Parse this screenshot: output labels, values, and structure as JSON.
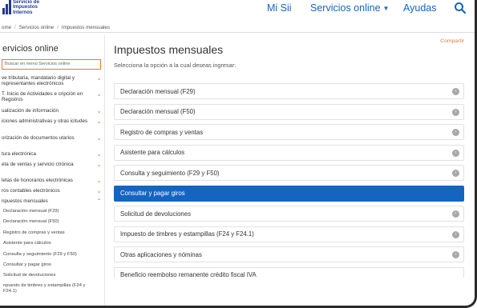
{
  "header": {
    "logo_line1": "Servicio de",
    "logo_line2": "Impuestos",
    "logo_line3": "Internos",
    "nav": {
      "mi_sii": "Mi Sii",
      "servicios": "Servicios online",
      "ayudas": "Ayudas"
    }
  },
  "breadcrumb": [
    "ome",
    "Servicios online",
    "Impuestos mensuales"
  ],
  "sidebar": {
    "title": "ervicios online",
    "search_placeholder": "Buscar en menú Servicios online",
    "items": [
      {
        "label": "ve tributaria, mandatario digital y representantes electrónicos"
      },
      {
        "label": "T. Inicio de Actividades e cripción en Registros"
      },
      {
        "label": "ualización de información"
      },
      {
        "label": "iciones administrativas y otras icitudes"
      },
      {
        "label": "orización de documentos utarios"
      },
      {
        "label": "tura electrónica"
      },
      {
        "label": "eta de ventas y servicio ctrónica"
      },
      {
        "label": "letas de honorarios electrónicas"
      },
      {
        "label": "ros contables electrónicos"
      },
      {
        "label": "npuestos mensuales"
      }
    ],
    "sub_items": [
      "Declaración mensual (F29)",
      "Declaración mensual (F50)",
      "Registro de compras y ventas",
      "Asistente para cálculos",
      "Consulta y seguimiento (F29 y F50)",
      "Consultar y pagar giros",
      "Solicitud de devoluciones",
      "npuesto de timbres y estampillas (F24 y F24.1)"
    ]
  },
  "main": {
    "title": "Impuestos mensuales",
    "share": "Compartir",
    "subtitle": "Selecciona la opción a la cual deseas ingresar:",
    "options": [
      {
        "label": "Declaración mensual (F29)"
      },
      {
        "label": "Declaración mensual (F50)"
      },
      {
        "label": "Registro de compras y ventas"
      },
      {
        "label": "Asistente para cálculos"
      },
      {
        "label": "Consulta y seguimiento (F29 y F50)"
      },
      {
        "label": "Consultar y pagar giros"
      },
      {
        "label": "Solicitud de devoluciones"
      },
      {
        "label": "Impuesto de timbres y estampillas (F24 y F24.1)"
      },
      {
        "label": "Otras aplicaciones y nóminas"
      },
      {
        "label": "Beneficio reembolso remanente crédito fiscal IVA"
      }
    ]
  },
  "colors": {
    "brand_blue": "#1565c0",
    "accent_orange": "#e07b3c",
    "logo_blue": "#1f3a93"
  }
}
